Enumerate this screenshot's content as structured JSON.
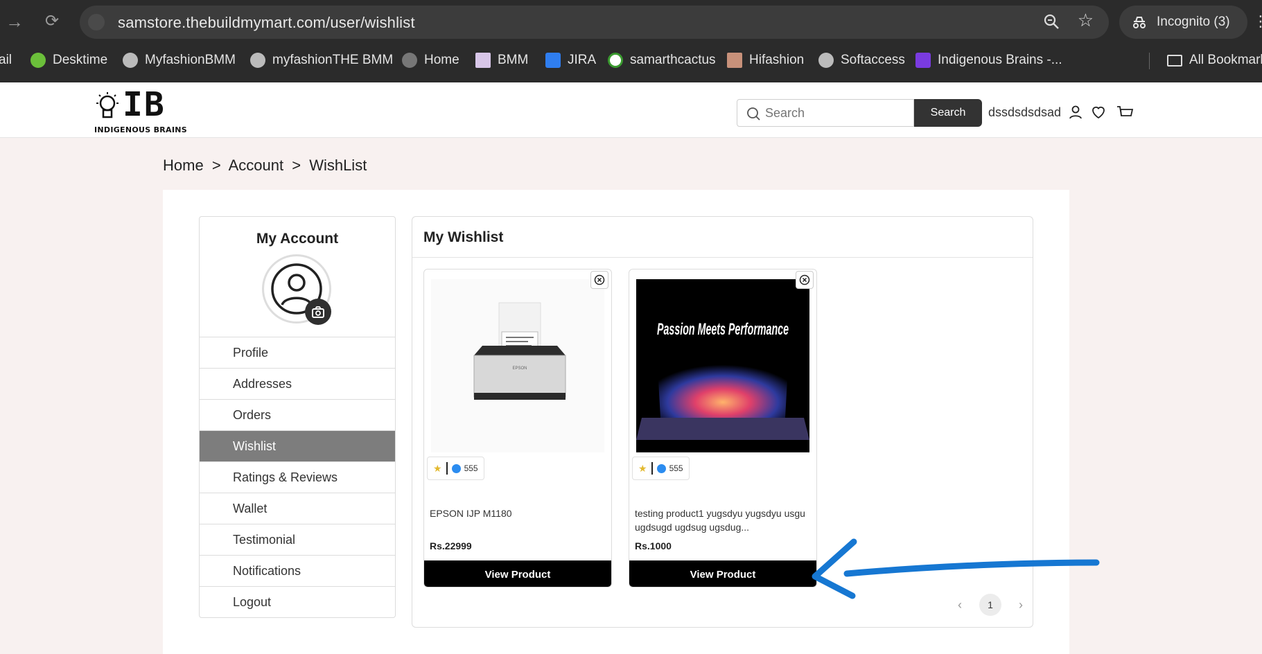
{
  "browser": {
    "url": "samstore.thebuildmymart.com/user/wishlist",
    "incognito_label": "Incognito (3)",
    "bookmarks": [
      {
        "label": "ail",
        "icon": "mail-icon"
      },
      {
        "label": "Desktime",
        "icon": "desktime-icon"
      },
      {
        "label": "MyfashionBMM",
        "icon": "globe-icon"
      },
      {
        "label": "myfashionTHE BMM",
        "icon": "globe-icon"
      },
      {
        "label": "Home",
        "icon": "globe-icon"
      },
      {
        "label": "BMM",
        "icon": "bmm-icon"
      },
      {
        "label": "JIRA",
        "icon": "jira-icon"
      },
      {
        "label": "samarthcactus",
        "icon": "cactus-icon"
      },
      {
        "label": "Hifashion",
        "icon": "hifashion-icon"
      },
      {
        "label": "Softaccess",
        "icon": "globe-icon"
      },
      {
        "label": "Indigenous Brains -...",
        "icon": "ib-icon"
      }
    ],
    "all_bookmarks_label": "All Bookmarks"
  },
  "header": {
    "logo_text": "IB",
    "logo_subtext": "INDIGENOUS BRAINS",
    "search_placeholder": "Search",
    "search_button": "Search",
    "username": "dssdsdsdsad"
  },
  "breadcrumb": {
    "home": "Home",
    "sep1": ">",
    "account": "Account",
    "sep2": ">",
    "current": "WishList"
  },
  "account": {
    "title": "My Account",
    "menu": [
      "Profile",
      "Addresses",
      "Orders",
      "Wishlist",
      "Ratings & Reviews",
      "Wallet",
      "Testimonial",
      "Notifications",
      "Logout"
    ],
    "active": "Wishlist"
  },
  "wishlist": {
    "title": "My Wishlist",
    "products": [
      {
        "name": "EPSON IJP M1180",
        "price": "Rs.22999",
        "rating_count": "555",
        "button": "View Product",
        "image_label": "EPSON"
      },
      {
        "name": "testing product1 yugsdyu yugsdyu usgu ugdsugd ugdsug ugsdug...",
        "price": "Rs.1000",
        "rating_count": "555",
        "button": "View Product",
        "image_label": "Passion Meets Performance"
      }
    ],
    "pagination": {
      "prev": "‹",
      "page": "1",
      "next": "›"
    }
  },
  "colors": {
    "accent": "#333333",
    "annotation": "#1677d2",
    "active_menu": "#7d7d7d"
  }
}
